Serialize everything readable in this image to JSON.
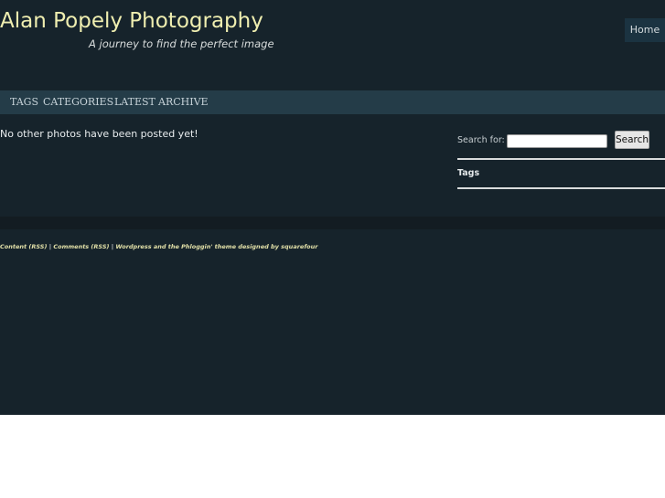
{
  "header": {
    "title": "Alan Popely Photography",
    "tagline": "A journey to find the perfect image",
    "home_label": "Home"
  },
  "nav": [
    "TAGS",
    "CATEGORIES",
    "LATEST",
    "ARCHIVE"
  ],
  "main": {
    "message": "No other photos have been posted yet!"
  },
  "sidebar": {
    "search_label": "Search for:",
    "search_value": "",
    "search_button": "Search",
    "tags_heading": "Tags"
  },
  "footer": {
    "content_rss": "Content (RSS)",
    "separator": "|",
    "comments_rss": "Comments (RSS)",
    "credit": "Wordpress and the Phloggin' theme designed by squarefour"
  }
}
